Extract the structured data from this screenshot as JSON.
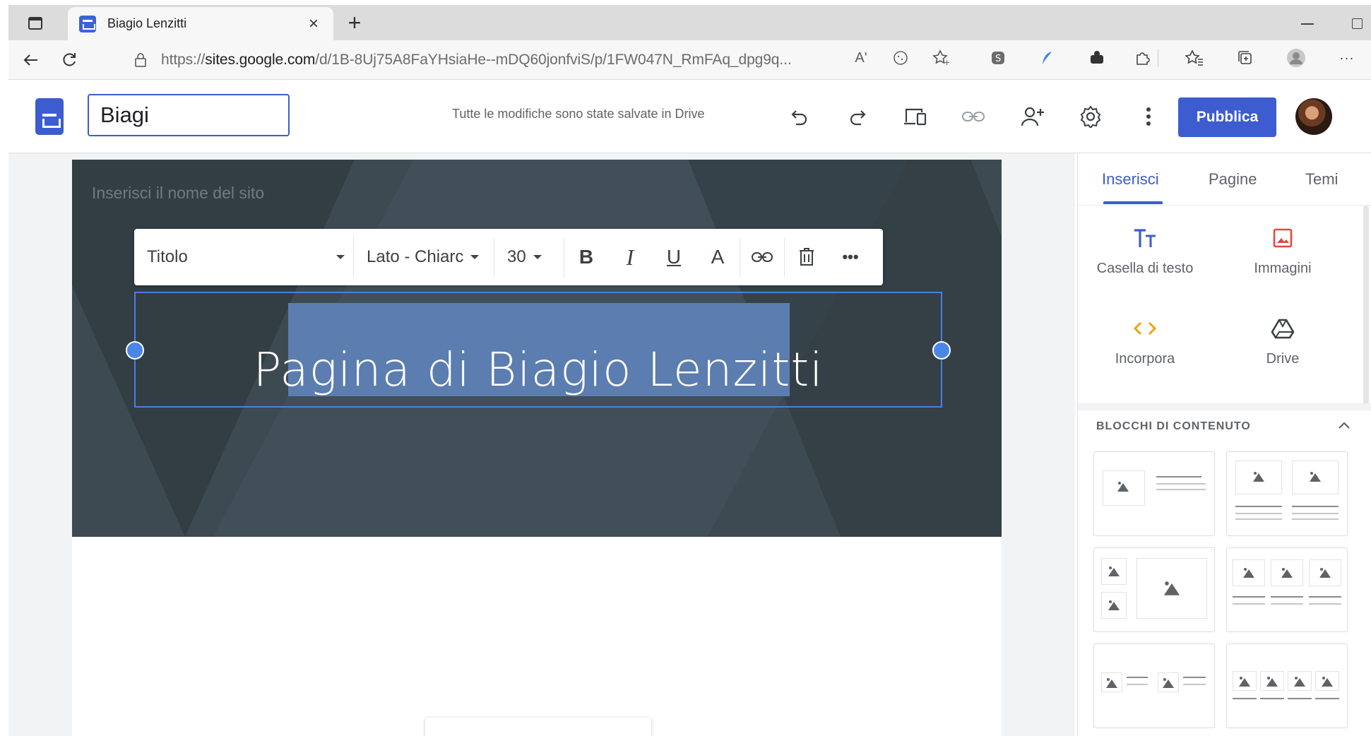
{
  "browser": {
    "tab_title": "Biagio Lenzitti",
    "tab_close": "×",
    "new_tab": "+",
    "url_prefix": "https://",
    "url_domain": "sites.google.com",
    "url_path": "/d/1B-8Uj75A8FaYHsiaHe--mDQ60jonfviS/p/1FW047N_RmFAq_dpg9q...",
    "read_aloud": "Aʹ",
    "icons": [
      "tab-actions-icon",
      "back-icon",
      "reload-icon",
      "lock-icon",
      "read-aloud-icon",
      "tracking-prevention-icon",
      "favorite-icon",
      "extension-icon",
      "feather-icon",
      "extension-puzzle-icon",
      "extensions-icon",
      "favorites-icon",
      "collections-icon",
      "profile-icon",
      "more-icon"
    ]
  },
  "app": {
    "doc_title_value": "Biagi",
    "save_status": "Tutte le modifiche sono state salvate in Drive",
    "publish_label": "Pubblica",
    "icons": [
      "undo-icon",
      "redo-icon",
      "preview-icon",
      "link-icon",
      "share-icon",
      "settings-icon",
      "more-vert-icon"
    ]
  },
  "editor": {
    "site_name_placeholder": "Inserisci il nome del sito",
    "toolbar": {
      "style_value": "Titolo",
      "font_value": "Lato - Chiarc",
      "size_value": "30",
      "bold": "B",
      "italic": "I",
      "underline": "U",
      "text_color": "A",
      "more": "•••"
    },
    "title_text": "Pagina di Biagio Lenzitti"
  },
  "panel": {
    "tabs": [
      "Inserisci",
      "Pagine",
      "Temi"
    ],
    "active_tab": "Inserisci",
    "insert_items": [
      {
        "label": "Casella di testo",
        "icon": "text-box-icon"
      },
      {
        "label": "Immagini",
        "icon": "image-icon"
      },
      {
        "label": "Incorpora",
        "icon": "embed-icon"
      },
      {
        "label": "Drive",
        "icon": "drive-icon"
      }
    ],
    "blocks_heading": "BLOCCHI DI CONTENUTO"
  },
  "colors": {
    "accent": "#3c5ccf",
    "header_bg": "#3d4a52",
    "selection": "#5b7db0",
    "image_icon": "#e04b3c",
    "embed_icon": "#f2a20e"
  }
}
